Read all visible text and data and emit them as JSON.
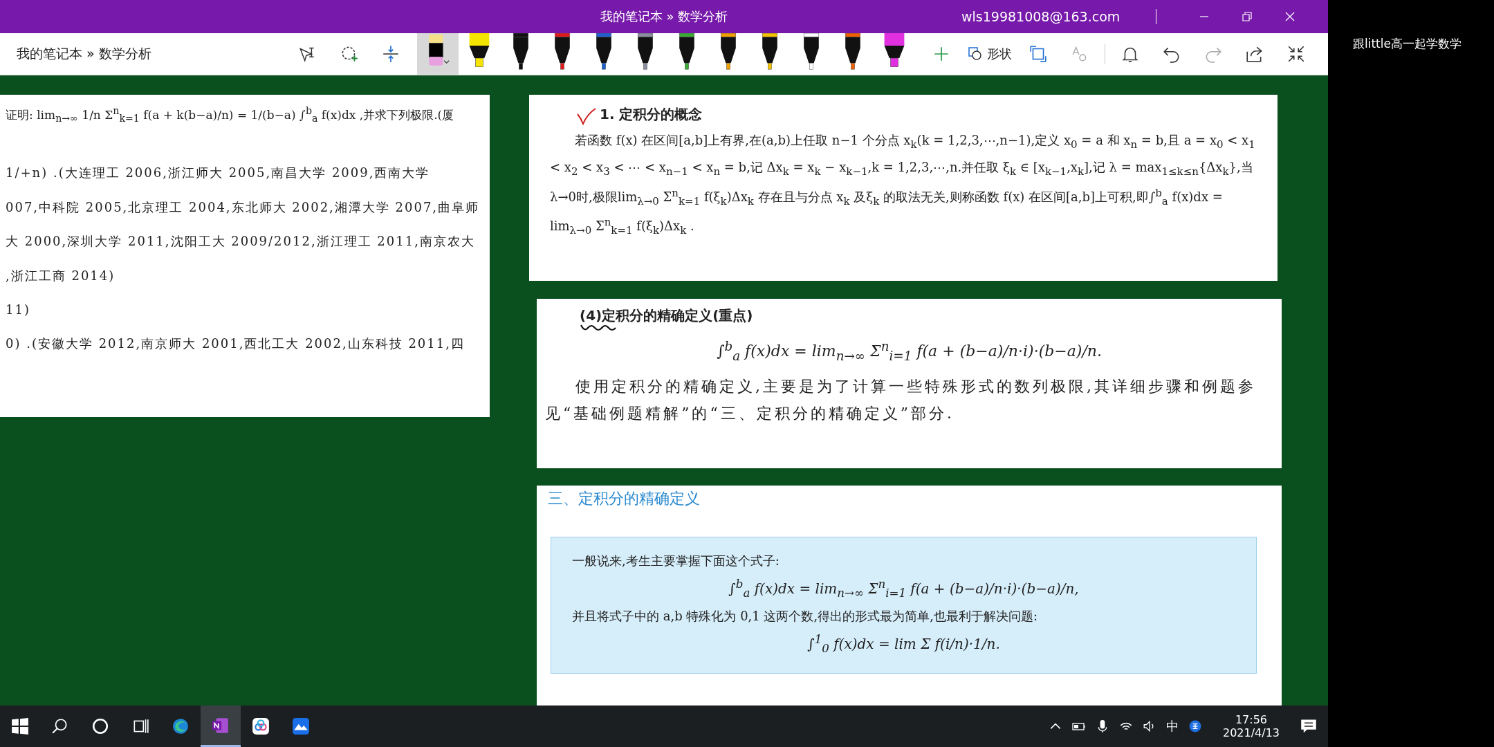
{
  "window": {
    "title": "我的笔记本 » 数学分析",
    "account": "wls19981008@163.com"
  },
  "toolbar": {
    "breadcrumb": "我的笔记本 » 数学分析",
    "shapes_label": "形状",
    "pens": [
      {
        "kind": "swatch",
        "color": "#000000",
        "selected": true
      },
      {
        "kind": "highlighter",
        "color": "#f5e400",
        "selected": false
      },
      {
        "kind": "pen",
        "color": "#111111",
        "selected": false
      },
      {
        "kind": "pen",
        "color": "#e01b1b",
        "selected": false
      },
      {
        "kind": "pen",
        "color": "#1f5fd0",
        "selected": false
      },
      {
        "kind": "pen",
        "color": "#8a8fa0",
        "selected": false
      },
      {
        "kind": "pen",
        "color": "#3aaa35",
        "selected": false
      },
      {
        "kind": "pen",
        "color": "#f0a000",
        "selected": false
      },
      {
        "kind": "pen",
        "color": "#f5c400",
        "selected": false
      },
      {
        "kind": "pen",
        "color": "#ffffff",
        "selected": false
      },
      {
        "kind": "pen",
        "color": "#f06000",
        "selected": false
      },
      {
        "kind": "highlighter",
        "color": "#e030e0",
        "selected": false
      }
    ]
  },
  "page": {
    "clips": [
      {
        "kind": "exercise",
        "lines": [
          "证明: lim$_{n→∞}$ 1/n Σ$^{n}$$_{k=1}$ f(a + k(b−a)/n) = 1/(b−a) ∫$^{b}$$_{a}$ f(x)dx ,并求下列极限.(厦",
          "1/+n) .(大连理工 2006,浙江师大 2005,南昌大学 2009,西南大学",
          "007,中科院 2005,北京理工 2004,东北师大 2002,湘潭大学 2007,曲阜师",
          "大 2000,深圳大学 2011,沈阳工大 2009/2012,浙江理工 2011,南京农大",
          ",浙江工商 2014)",
          "11)",
          "0) .(安徽大学 2012,南京师大 2001,西北工大 2002,山东科技 2011,四"
        ]
      },
      {
        "kind": "concept",
        "heading": "1. 定积分的概念",
        "ink_check": true,
        "paragraphs": [
          "若函数 f(x) 在区间[a,b]上有界,在(a,b)上任取 n−1 个分点 x$_{k}$(k = 1,2,3,⋯,n−1),定义 x$_{0}$ = a 和 x$_{n}$ = b,且 a = x$_{0}$ < x$_{1}$ < x$_{2}$ < x$_{3}$ < ⋯ < x$_{n−1}$ < x$_{n}$ = b,记 Δx$_{k}$ = x$_{k}$ − x$_{k−1}$,k = 1,2,3,⋯,n.并任取 ξ$_{k}$ ∈ [x$_{k−1}$,x$_{k}$],记 λ = max$_{1≤k≤n}${Δx$_{k}$},当λ→0时,极限lim$_{λ→0}$ Σ$^{n}$$_{k=1}$ f(ξ$_{k}$)Δx$_{k}$ 存在且与分点 x$_{k}$ 及ξ$_{k}$ 的取法无关,则称函数 f(x) 在区间[a,b]上可积,即∫$^{b}$$_{a}$ f(x)dx = lim$_{λ→0}$ Σ$^{n}$$_{k=1}$ f(ξ$_{k}$)Δx$_{k}$ ."
        ]
      },
      {
        "kind": "definition",
        "heading": "(4)定积分的精确定义(重点)",
        "ink_underline": true,
        "formula": "∫$^{b}$$_{a}$ f(x)dx = lim$_{n→∞}$ Σ$^{n}$$_{i=1}$ f(a + (b−a)/n·i)·(b−a)/n.",
        "paragraphs": [
          "使用定积分的精确定义,主要是为了计算一些特殊形式的数列极限,其详细步骤和例题参见“基础例题精解”的“三、定积分的精确定义”部分."
        ]
      },
      {
        "kind": "boxed",
        "heading": "三、定积分的精确定义",
        "items": [
          {
            "kind": "text",
            "text": "一般说来,考生主要掌握下面这个式子:"
          },
          {
            "kind": "formula",
            "text": "∫$^{b}$$_{a}$ f(x)dx = lim$_{n→∞}$ Σ$^{n}$$_{i=1}$ f(a + (b−a)/n·i)·(b−a)/n,"
          },
          {
            "kind": "text",
            "text": "并且将式子中的 a,b 特殊化为 0,1 这两个数,得出的形式最为简单,也最利于解决问题:"
          },
          {
            "kind": "formula",
            "text": "∫$^{1}$$_{0}$ f(x)dx = lim Σ f(i/n)·1/n."
          }
        ]
      }
    ]
  },
  "taskbar": {
    "apps": [
      {
        "kind": "start",
        "selected": false
      },
      {
        "kind": "search",
        "selected": false
      },
      {
        "kind": "cortana",
        "selected": false
      },
      {
        "kind": "taskview",
        "selected": false
      },
      {
        "kind": "edge",
        "selected": false
      },
      {
        "kind": "onenote",
        "selected": true
      },
      {
        "kind": "cloud",
        "selected": false
      },
      {
        "kind": "bluebird",
        "selected": false
      }
    ],
    "ime": "中",
    "time": "17:56",
    "date": "2021/4/13"
  },
  "side_label": "跟little高一起学数学"
}
